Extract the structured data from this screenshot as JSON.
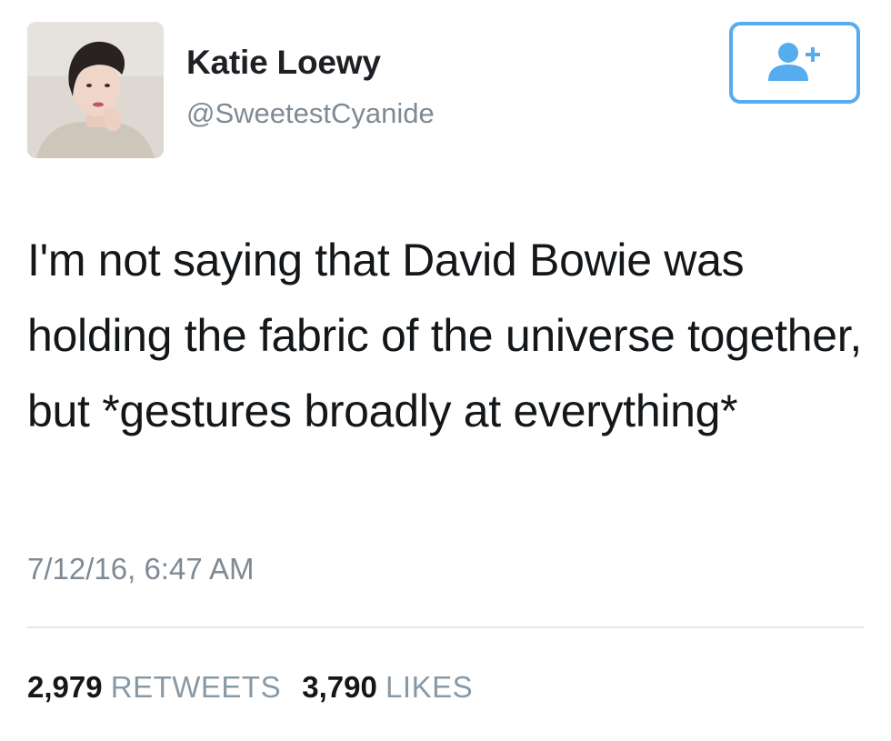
{
  "author": {
    "name": "Katie Loewy",
    "handle": "@SweetestCyanide"
  },
  "follow_button": {
    "icon": "add-user-icon",
    "color": "#55acee"
  },
  "tweet": {
    "text": "I'm not saying that David Bowie was holding the fabric of the universe together, but *gestures broadly at everything*",
    "timestamp": "7/12/16, 6:47 AM"
  },
  "stats": {
    "retweets_count": "2,979",
    "retweets_label": "RETWEETS",
    "likes_count": "3,790",
    "likes_label": "LIKES"
  }
}
